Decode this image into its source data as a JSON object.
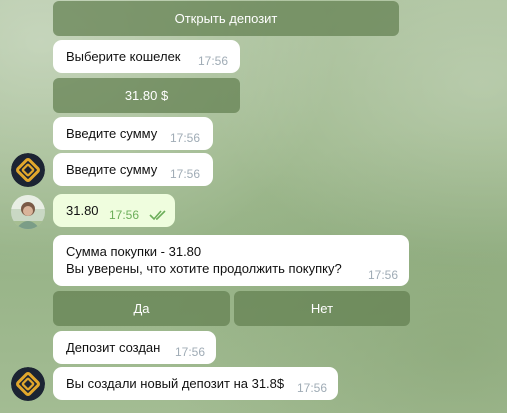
{
  "chat": {
    "buttons": {
      "open_deposit": "Открыть депозит",
      "amount": "31.80 $",
      "yes": "Да",
      "no": "Нет"
    },
    "messages": [
      {
        "text": "Выберите кошелек",
        "time": "17:56"
      },
      {
        "text": "Введите сумму",
        "time": "17:56"
      },
      {
        "text": "Введите сумму",
        "time": "17:56"
      },
      {
        "text": "31.80",
        "time": "17:56",
        "status": "read"
      },
      {
        "lines": [
          "Сумма покупки - 31.80",
          "Вы уверены, что хотите продолжить покупку?"
        ],
        "time": "17:56"
      },
      {
        "text": "Депозит создан",
        "time": "17:56"
      },
      {
        "text": "Вы создали новый депозит на 31.8$",
        "time": "17:56"
      }
    ]
  },
  "colors": {
    "bot_avatar_bg": "#1c2433",
    "bot_avatar_accent": "#e2a72c",
    "button_bg": "#628050",
    "outgoing_bubble": "#effdde",
    "read_check": "#6cae5a"
  },
  "icons": {
    "bot_avatar": "bot-logo-icon",
    "user_avatar": "user-photo-avatar",
    "read_status": "double-check-icon"
  }
}
